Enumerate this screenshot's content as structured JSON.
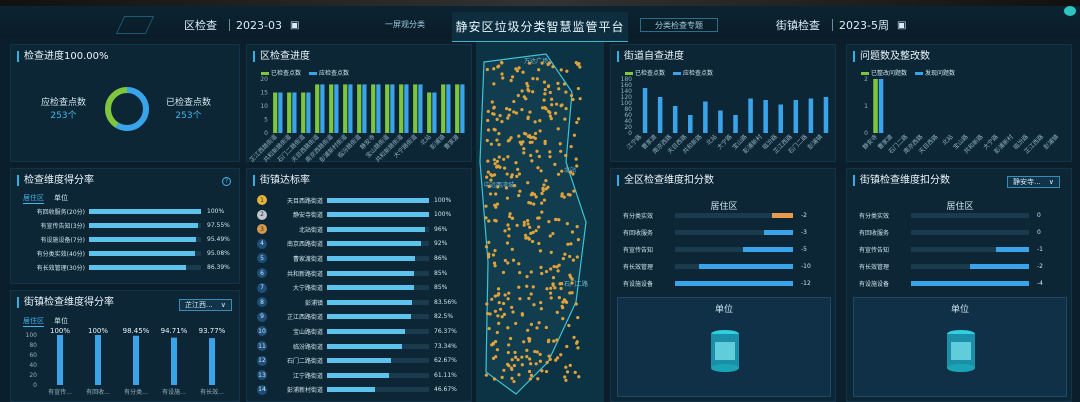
{
  "header": {
    "title": "静安区垃圾分类智慧监管平台",
    "left_filter": {
      "label": "区检查",
      "date": "2023-03"
    },
    "left_tab": "一屏观分类",
    "right_tab": "分类检查专题",
    "right_filter": {
      "label": "街镇检查",
      "date": "2023-5周"
    }
  },
  "progress_panel": {
    "title": "检查进度100.00%",
    "should_label": "应检查点数",
    "should_value": "253个",
    "done_label": "已检查点数",
    "done_value": "253个"
  },
  "district_progress": {
    "title": "区检查进度",
    "legend": [
      "已检查点数",
      "应检查点数"
    ],
    "yticks": [
      "20",
      "15",
      "10",
      "5",
      "0"
    ],
    "chart_data": {
      "type": "bar",
      "ylim": [
        0,
        20
      ],
      "categories": [
        "芷江西路街道",
        "共和新路街道",
        "石门二路街道",
        "天目西路街道",
        "南京西路街道",
        "彭浦新村街道",
        "临汾路街道",
        "静安寺",
        "宝山路街道",
        "共和新路街道",
        "大宁路街道",
        "北站",
        "彭浦镇",
        "曹家渡"
      ],
      "series": [
        {
          "name": "已检查点数",
          "values": [
            15,
            15,
            15,
            18,
            18,
            18,
            18,
            18,
            18,
            18,
            18,
            15,
            18,
            18
          ]
        },
        {
          "name": "应检查点数",
          "values": [
            15,
            15,
            15,
            18,
            18,
            18,
            18,
            18,
            18,
            18,
            18,
            15,
            18,
            18
          ]
        }
      ]
    }
  },
  "street_self_check": {
    "title": "街道自查进度",
    "legend": [
      "已检查点数",
      "应检查点数"
    ],
    "yticks": [
      "180",
      "160",
      "140",
      "120",
      "100",
      "80",
      "60",
      "40",
      "20",
      "0"
    ],
    "chart_data": {
      "type": "bar",
      "ylim": [
        0,
        180
      ],
      "categories": [
        "江宁路",
        "曹家渡",
        "南京西路",
        "天目西路",
        "共和新路",
        "北站",
        "大宁路",
        "宝山路",
        "彭浦新村",
        "临汾路",
        "芷江西路",
        "石门二路",
        "彭浦镇"
      ],
      "series": [
        {
          "name": "已检查点数",
          "values": [
            0,
            0,
            0,
            0,
            0,
            0,
            0,
            0,
            0,
            0,
            0,
            0,
            0
          ]
        },
        {
          "name": "应检查点数",
          "values": [
            150,
            120,
            90,
            60,
            105,
            75,
            60,
            115,
            110,
            95,
            110,
            115,
            120
          ]
        }
      ]
    }
  },
  "issues": {
    "title": "问题数及整改数",
    "legend": [
      "已整改问题数",
      "发现问题数"
    ],
    "yticks": [
      "2",
      "1",
      "0"
    ],
    "chart_data": {
      "type": "bar",
      "ylim": [
        0,
        2
      ],
      "categories": [
        "静安寺",
        "曹家渡",
        "石门二路",
        "南京西路",
        "天目西路",
        "北站",
        "宝山路",
        "共和新路",
        "大宁路",
        "彭浦新村",
        "临汾路",
        "芷江西路",
        "彭浦镇"
      ],
      "series": [
        {
          "name": "已整改问题数",
          "values": [
            2,
            0,
            0,
            0,
            0,
            0,
            0,
            0,
            0,
            0,
            0,
            0,
            0
          ]
        },
        {
          "name": "发现问题数",
          "values": [
            2,
            0,
            0,
            0,
            0,
            0,
            0,
            0,
            0,
            0,
            0,
            0,
            0
          ]
        }
      ]
    }
  },
  "dim_score": {
    "title": "检查维度得分率",
    "tabs": [
      "居住区",
      "单位"
    ],
    "rows": [
      {
        "label": "有回收服务(20分)",
        "value": "100%",
        "pct": 100
      },
      {
        "label": "有宣传告知(3分)",
        "value": "97.55%",
        "pct": 97.55
      },
      {
        "label": "有设施设备(7分)",
        "value": "95.49%",
        "pct": 95.49
      },
      {
        "label": "有分类实效(40分)",
        "value": "95.08%",
        "pct": 95.08
      },
      {
        "label": "有长效管理(30分)",
        "value": "86.39%",
        "pct": 86.39
      }
    ]
  },
  "street_dim_score": {
    "title": "街镇检查维度得分率",
    "dropdown": "芷江西...",
    "tabs": [
      "居住区",
      "单位"
    ],
    "yticks": [
      "100",
      "80",
      "60",
      "40",
      "20",
      "0"
    ],
    "chart_data": {
      "type": "bar",
      "ylim": [
        0,
        100
      ],
      "categories": [
        "有宣传...",
        "有回收...",
        "有分类...",
        "有设施...",
        "有长效..."
      ],
      "values": [
        100,
        100,
        98.45,
        94.71,
        93.77
      ],
      "labels": [
        "100%",
        "100%",
        "98.45%",
        "94.71%",
        "93.77%"
      ]
    }
  },
  "street_rate": {
    "title": "街镇达标率",
    "rows": [
      {
        "rank": "1",
        "name": "天目西路街道",
        "value": "100%",
        "pct": 100
      },
      {
        "rank": "2",
        "name": "静安寺街道",
        "value": "100%",
        "pct": 100
      },
      {
        "rank": "3",
        "name": "北站街道",
        "value": "96%",
        "pct": 96
      },
      {
        "rank": "4",
        "name": "南京西路街道",
        "value": "92%",
        "pct": 92
      },
      {
        "rank": "5",
        "name": "曹家渡街道",
        "value": "86%",
        "pct": 86
      },
      {
        "rank": "6",
        "name": "共和新路街道",
        "value": "85%",
        "pct": 85
      },
      {
        "rank": "7",
        "name": "大宁路街道",
        "value": "85%",
        "pct": 85
      },
      {
        "rank": "8",
        "name": "彭浦镇",
        "value": "83.56%",
        "pct": 83.56
      },
      {
        "rank": "9",
        "name": "芷江西路街道",
        "value": "82.5%",
        "pct": 82.5
      },
      {
        "rank": "10",
        "name": "宝山路街道",
        "value": "76.37%",
        "pct": 76.37
      },
      {
        "rank": "11",
        "name": "临汾路街道",
        "value": "73.34%",
        "pct": 73.34
      },
      {
        "rank": "12",
        "name": "石门二路街道",
        "value": "62.67%",
        "pct": 62.67
      },
      {
        "rank": "13",
        "name": "江宁路街道",
        "value": "61.11%",
        "pct": 61.11
      },
      {
        "rank": "14",
        "name": "彭浦新村街道",
        "value": "46.67%",
        "pct": 46.67
      }
    ]
  },
  "district_deduct": {
    "title": "全区检查维度扣分数",
    "sub": "居住区",
    "rows": [
      {
        "label": "有分类实效",
        "value": "-2",
        "pct": 18
      },
      {
        "label": "有回收服务",
        "value": "-3",
        "pct": 25
      },
      {
        "label": "有宣传告知",
        "value": "-5",
        "pct": 42
      },
      {
        "label": "有长效管理",
        "value": "-10",
        "pct": 80
      },
      {
        "label": "有设施设备",
        "value": "-12",
        "pct": 100
      }
    ],
    "unit_title": "单位"
  },
  "street_deduct": {
    "title": "街镇检查维度扣分数",
    "dropdown": "静安寺...",
    "sub": "居住区",
    "rows": [
      {
        "label": "有分类实效",
        "value": "0",
        "pct": 0
      },
      {
        "label": "有回收服务",
        "value": "0",
        "pct": 0
      },
      {
        "label": "有宣传告知",
        "value": "-1",
        "pct": 28
      },
      {
        "label": "有长效管理",
        "value": "-2",
        "pct": 50
      },
      {
        "label": "有设施设备",
        "value": "-4",
        "pct": 100
      }
    ],
    "unit_title": "单位"
  },
  "map": {
    "labels": [
      "万达广场",
      "曹家渡",
      "静安寺",
      "芷江西路",
      "大宁路",
      "中远两湾城",
      "天目西路",
      "南京西路",
      "北站",
      "石门二路",
      "共和新路"
    ]
  },
  "colors": {
    "green": "#7ec63c",
    "blue": "#3aa4ea",
    "accent": "#2ab4e6",
    "dot": "#e0a33c"
  }
}
